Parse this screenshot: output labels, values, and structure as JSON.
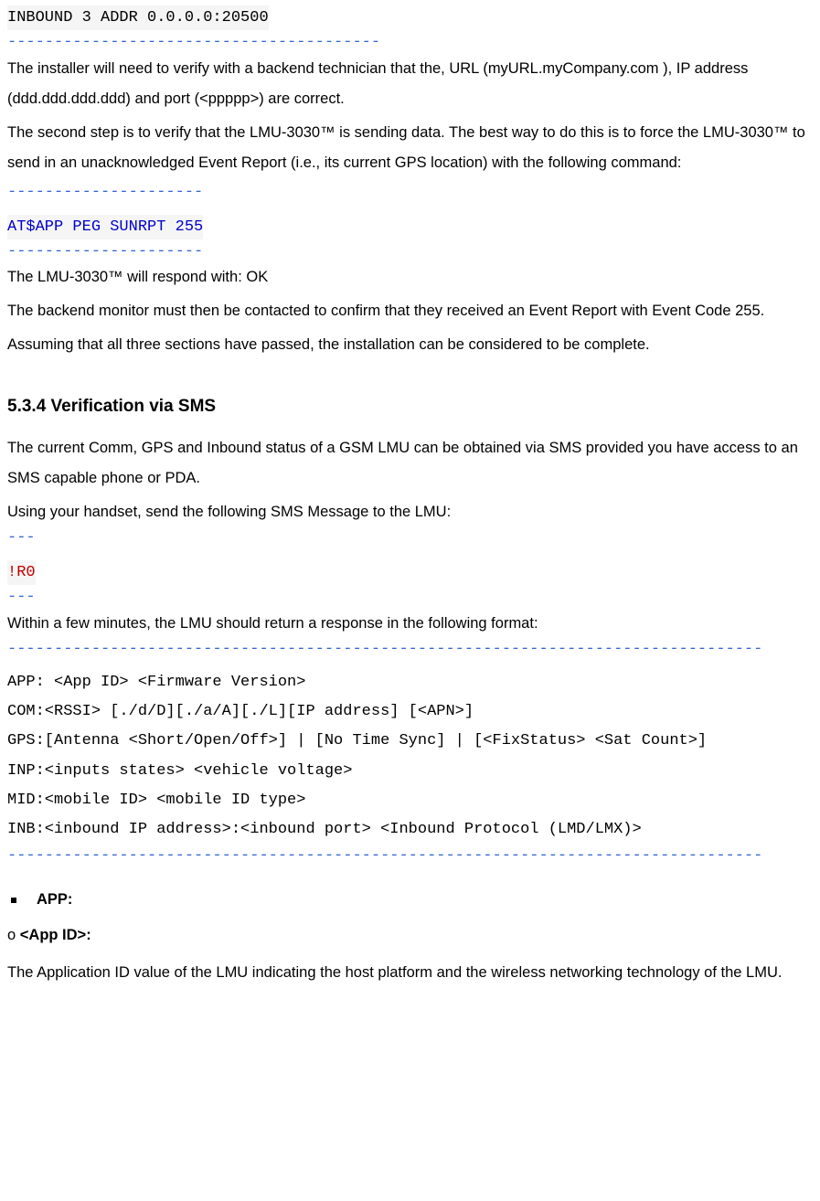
{
  "code1": {
    "line1": "INBOUND 3 ADDR 0.0.0.0:20500"
  },
  "dash40": "----------------------------------------",
  "para1": "The installer will need to verify with a backend technician that the, URL (myURL.myCompany.com ), IP address (ddd.ddd.ddd.ddd) and port (<ppppp>) are correct.",
  "para2": "The second step is to verify that the LMU-3030™ is sending data. The best way to do this is to force the LMU-3030™ to send in an unacknowledged Event Report (i.e., its current GPS location) with the following command:",
  "dash21": "---------------------",
  "code2": "AT$APP PEG SUNRPT 255",
  "para3": "The LMU-3030™ will respond with: OK",
  "para4": "The backend monitor must then be contacted to confirm that they received an Event Report with Event Code 255.",
  "para5": "Assuming that all three sections have passed, the installation can be considered to be complete.",
  "heading": "5.3.4 Verification via SMS",
  "para6": "The current Comm, GPS and Inbound status of a GSM LMU can be obtained via SMS provided you have access to an SMS capable phone or PDA.",
  "para7": "Using your handset, send the following SMS Message to the LMU:",
  "dash3": "---",
  "code3": "!R0",
  "para8": "Within a few minutes, the LMU should return a response in the following format:",
  "dashLong": "---------------------------------------------------------------------------------",
  "respBlock": {
    "l1": "APP: <App ID> <Firmware Version>",
    "l2": "COM:<RSSI> [./d/D][./a/A][./L][IP address] [<APN>]",
    "l3": "GPS:[Antenna <Short/Open/Off>] | [No Time Sync] | [<FixStatus> <Sat Count>]",
    "l4": "INP:<inputs states> <vehicle voltage>",
    "l5": "MID:<mobile ID> <mobile ID type>",
    "l6": "INB:<inbound IP address>:<inbound port> <Inbound Protocol (LMD/LMX)>"
  },
  "bulletApp": "APP:",
  "subO": "o ",
  "subAppId": "<App ID>:",
  "desc1": "The Application ID value of the LMU indicating the host platform and the wireless networking technology of the LMU."
}
